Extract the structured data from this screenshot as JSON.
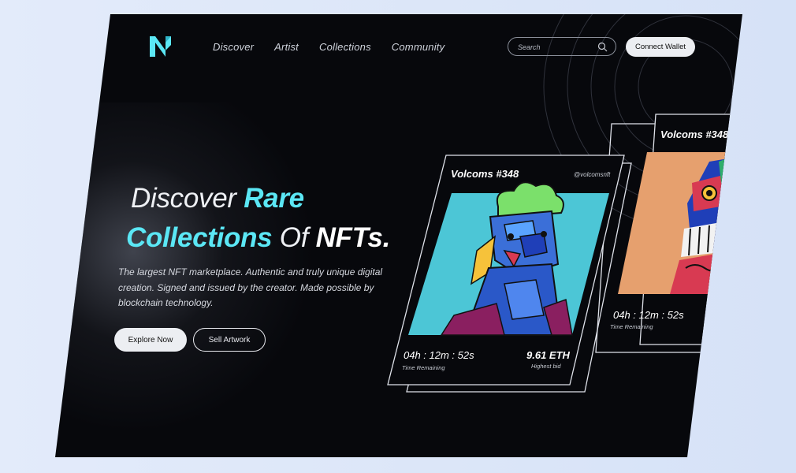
{
  "brand": {
    "logo_letter": "N",
    "accent_color": "#5be7f5"
  },
  "nav": {
    "items": [
      "Discover",
      "Artist",
      "Collections",
      "Community"
    ]
  },
  "search": {
    "placeholder": "Search",
    "icon": "search-icon"
  },
  "header": {
    "connect_label": "Connect Wallet"
  },
  "hero": {
    "line1_plain": "Discover",
    "line1_accent": "Rare",
    "line2_accent": "Collections",
    "line2_plain": "Of",
    "line2_bold": "NFTs.",
    "description": "The largest NFT marketplace. Authentic and truly unique digital creation. Signed and issued by the creator. Made possible by blockchain technology.",
    "explore_label": "Explore Now",
    "sell_label": "Sell Artwork"
  },
  "cards": [
    {
      "title": "Volcoms #348",
      "handle": "@volcomsnft",
      "timer": "04h : 12m : 52s",
      "timer_label": "Time Remaining",
      "price": "9.61 ETH",
      "price_label": "Highest bid"
    },
    {
      "title": "Volcoms #348",
      "timer": "04h : 12m : 52s",
      "timer_label": "Time Remaining"
    }
  ]
}
